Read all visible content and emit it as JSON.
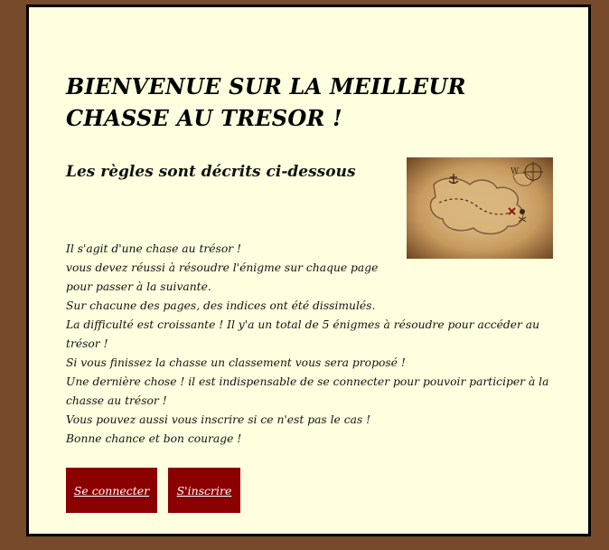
{
  "page": {
    "title": "BIENVENUE SUR LA MEILLEUR CHASSE AU TRESOR !",
    "subtitle": "Les règles sont décrits ci-dessous"
  },
  "rules": [
    "Il s'agit d'une chase au trésor !",
    "vous devez réussi à résoudre l'énigme sur chaque page pour passer à la suivante.",
    "Sur chacune des pages, des indices ont été dissimulés.",
    "La difficulté est croissante ! Il y'a un total de 5 énigmes à résoudre pour accéder au trésor !",
    "Si vous finissez la chasse un classement vous sera proposé !",
    "Une dernière chose ! il est indispensable de se connecter pour pouvoir participer à la chasse au trésor !",
    "Vous pouvez aussi vous inscrire si ce n'est pas le cas !",
    "Bonne chance et bon courage !"
  ],
  "buttons": {
    "login": "Se connecter",
    "register": "S'inscrire"
  },
  "colors": {
    "background": "#774a2c",
    "card": "#ffffdf",
    "button": "#8b0000"
  },
  "image": {
    "icon": "treasure-map-icon"
  }
}
